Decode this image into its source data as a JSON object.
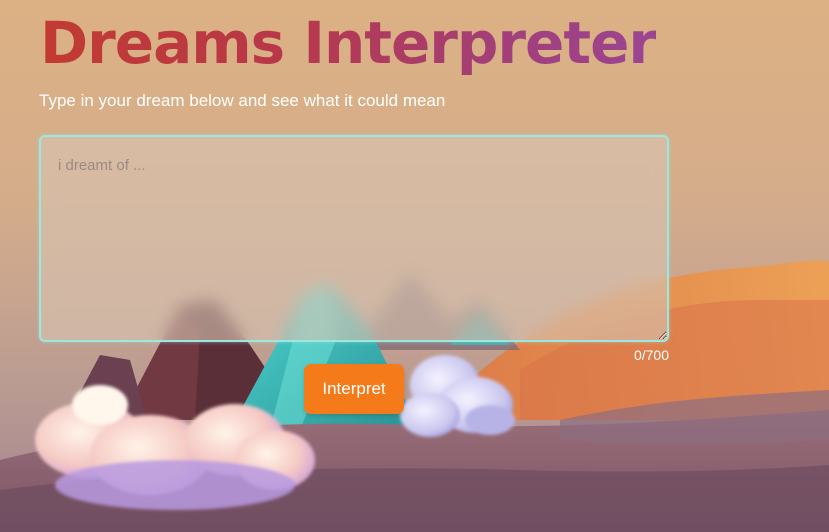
{
  "header": {
    "title": "Dreams Interpreter",
    "subtitle": "Type in your dream below and see what it could mean"
  },
  "form": {
    "dream_input": {
      "value": "",
      "placeholder": "i dreamt of ..."
    },
    "char_counter": "0/700",
    "interpret_label": "Interpret"
  },
  "colors": {
    "title_gradient_start": "#c23a32",
    "title_gradient_end": "#9b4592",
    "button": "#f47a1a",
    "input_border": "#9be8e0"
  }
}
